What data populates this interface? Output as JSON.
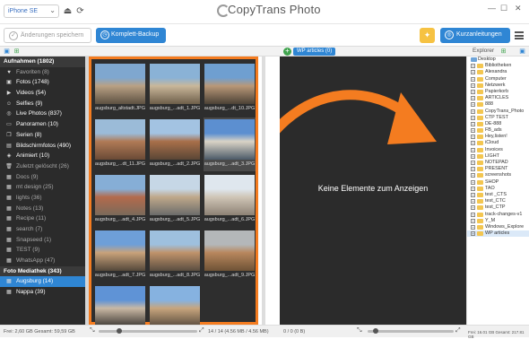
{
  "topbar": {
    "device": "iPhone SE",
    "app_name": "CopyTrans Photo"
  },
  "toolbar": {
    "save_label": "Änderungen speichern",
    "backup_label": "Komplett-Backup",
    "guides_label": "Kurzanleitungen"
  },
  "subbar": {
    "wp_tab": "WP articles (0)",
    "explorer_label": "Explorer"
  },
  "sidebar": {
    "items": [
      {
        "label": "Aufnahmen (1802)",
        "icon": "camera-roll-icon",
        "style": "header"
      },
      {
        "label": "Favoriten (8)",
        "icon": "heart-icon",
        "style": "dim"
      },
      {
        "label": "Fotos (1748)",
        "icon": "photo-icon",
        "style": ""
      },
      {
        "label": "Videos (54)",
        "icon": "video-icon",
        "style": ""
      },
      {
        "label": "Selfies (9)",
        "icon": "selfie-icon",
        "style": ""
      },
      {
        "label": "Live Photos (837)",
        "icon": "live-photo-icon",
        "style": ""
      },
      {
        "label": "Panoramen (10)",
        "icon": "panorama-icon",
        "style": ""
      },
      {
        "label": "Serien (8)",
        "icon": "burst-icon",
        "style": ""
      },
      {
        "label": "Bildschirmfotos (490)",
        "icon": "screenshot-icon",
        "style": ""
      },
      {
        "label": "Animiert (10)",
        "icon": "animated-icon",
        "style": ""
      },
      {
        "label": "Zuletzt gelöscht (26)",
        "icon": "trash-icon",
        "style": "dim"
      },
      {
        "label": "Docs (9)",
        "icon": "album-icon",
        "style": "dim"
      },
      {
        "label": "mt design (25)",
        "icon": "album-icon",
        "style": "dim"
      },
      {
        "label": "lights (36)",
        "icon": "album-icon",
        "style": "dim"
      },
      {
        "label": "Notes (13)",
        "icon": "album-icon",
        "style": "dim"
      },
      {
        "label": "Recipe (11)",
        "icon": "album-icon",
        "style": "dim"
      },
      {
        "label": "search (7)",
        "icon": "album-icon",
        "style": "dim"
      },
      {
        "label": "Snapseed (1)",
        "icon": "album-icon",
        "style": "dim"
      },
      {
        "label": "TEST (9)",
        "icon": "album-icon",
        "style": "dim"
      },
      {
        "label": "WhatsApp (47)",
        "icon": "album-icon",
        "style": "dim"
      },
      {
        "label": "Foto Mediathek (343)",
        "icon": "library-icon",
        "style": "header"
      },
      {
        "label": "Augsburg (14)",
        "icon": "album-icon",
        "style": "selected"
      },
      {
        "label": "Nappa (39)",
        "icon": "album-icon",
        "style": ""
      }
    ]
  },
  "photos": [
    {
      "caption": "augsburg_altstadt.JPG",
      "colors": [
        "#7fa7cf",
        "#b9a184",
        "#5d5142"
      ]
    },
    {
      "caption": "augsburg_...adt_1.JPG",
      "colors": [
        "#8ab2d6",
        "#c9b79a",
        "#6e5f4a"
      ]
    },
    {
      "caption": "augsburg_...dt_10.JPG",
      "colors": [
        "#6f9fd0",
        "#b99878",
        "#4c4236"
      ]
    },
    {
      "caption": "augsburg_...dt_11.JPG",
      "colors": [
        "#9bbbd8",
        "#b07a56",
        "#6a4a36"
      ]
    },
    {
      "caption": "augsburg_...adt_2.JPG",
      "colors": [
        "#a3c3e2",
        "#a86f4a",
        "#5a4636"
      ]
    },
    {
      "caption": "augsburg_...adt_3.JPG",
      "colors": [
        "#5c8fd0",
        "#d9d3c6",
        "#4b5a68"
      ]
    },
    {
      "caption": "augsburg_...adt_4.JPG",
      "colors": [
        "#86aed6",
        "#b36a4c",
        "#7a6a5a"
      ]
    },
    {
      "caption": "augsburg_...adt_5.JPG",
      "colors": [
        "#c6d7e6",
        "#bfa88a",
        "#6b6b6b"
      ]
    },
    {
      "caption": "augsburg_...adt_6.JPG",
      "colors": [
        "#dfe7ee",
        "#cfc5b6",
        "#8d8275"
      ]
    },
    {
      "caption": "augsburg_...adt_7.JPG",
      "colors": [
        "#6e9fd8",
        "#c8a27a",
        "#54483a"
      ]
    },
    {
      "caption": "augsburg_...adt_8.JPG",
      "colors": [
        "#9ec0de",
        "#c0936b",
        "#5a4d40"
      ]
    },
    {
      "caption": "augsburg_...adt_9.JPG",
      "colors": [
        "#b4b7b9",
        "#b8875d",
        "#6e5236"
      ]
    },
    {
      "caption": "",
      "colors": [
        "#5f93d6",
        "#c9b8a4",
        "#3e3a35"
      ]
    },
    {
      "caption": "",
      "colors": [
        "#86b2e0",
        "#c7a57d",
        "#5b4d3f"
      ]
    }
  ],
  "middle": {
    "empty_message": "Keine Elemente zum Anzeigen"
  },
  "explorer": {
    "root": "Desktop",
    "items": [
      {
        "label": "Bibliotheken",
        "sel": false
      },
      {
        "label": "Alexandra",
        "sel": false
      },
      {
        "label": "Computer",
        "sel": false
      },
      {
        "label": "Netzwerk",
        "sel": false
      },
      {
        "label": "Papierkorb",
        "sel": false
      },
      {
        "label": "ARTICLES",
        "sel": false
      },
      {
        "label": "888",
        "sel": false
      },
      {
        "label": "CopyTrans_Photo",
        "sel": false
      },
      {
        "label": "CTP TEST",
        "sel": false
      },
      {
        "label": "DE-888",
        "sel": false
      },
      {
        "label": "FB_ads",
        "sel": false
      },
      {
        "label": "Hey,listen!",
        "sel": false
      },
      {
        "label": "iCloud",
        "sel": false
      },
      {
        "label": "Invoices",
        "sel": false
      },
      {
        "label": "LIGHT",
        "sel": false
      },
      {
        "label": "NOTEPAD",
        "sel": false
      },
      {
        "label": "PRESENT",
        "sel": false
      },
      {
        "label": "screenshots",
        "sel": false
      },
      {
        "label": "SHOP",
        "sel": false
      },
      {
        "label": "TAO",
        "sel": false
      },
      {
        "label": "test _CTS",
        "sel": false
      },
      {
        "label": "test_CTC",
        "sel": false
      },
      {
        "label": "test_CTP",
        "sel": false
      },
      {
        "label": "track-changes-v1",
        "sel": false
      },
      {
        "label": "Y_M",
        "sel": false
      },
      {
        "label": "Windows_Explore",
        "sel": false
      },
      {
        "label": "WP articles",
        "sel": true
      }
    ]
  },
  "status": {
    "left_free": "Frei: 2,60 GB Gesamt: 59,59 GB",
    "center_count": "14 / 14 (4.56 MB / 4.56 MB)",
    "middle_count": "0 / 0 (0 B)",
    "right_free": "Frei: 16.01 GB Gesamt: 217.81 GB"
  },
  "colors": {
    "accent": "#2f86d4",
    "highlight_border": "#f47c20",
    "dark_panel": "#2b2b2b",
    "lightbulb": "#f6c242"
  }
}
